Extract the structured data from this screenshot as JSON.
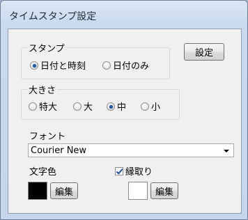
{
  "window": {
    "title": "タイムスタンプ設定"
  },
  "stamp_group": {
    "title": "スタンプ",
    "options": [
      {
        "label": "日付と時刻",
        "checked": true
      },
      {
        "label": "日付のみ",
        "checked": false
      }
    ]
  },
  "settings_button": {
    "label": "設定"
  },
  "size_group": {
    "title": "大きさ",
    "options": [
      {
        "label": "特大",
        "checked": false
      },
      {
        "label": "大",
        "checked": false
      },
      {
        "label": "中",
        "checked": true
      },
      {
        "label": "小",
        "checked": false
      }
    ]
  },
  "font": {
    "label": "フォント",
    "value": "Courier New"
  },
  "text_color": {
    "label": "文字色",
    "color": "#000000",
    "edit_label": "編集"
  },
  "border": {
    "label": "縁取り",
    "checked": true,
    "color": "#ffffff",
    "edit_label": "編集"
  }
}
